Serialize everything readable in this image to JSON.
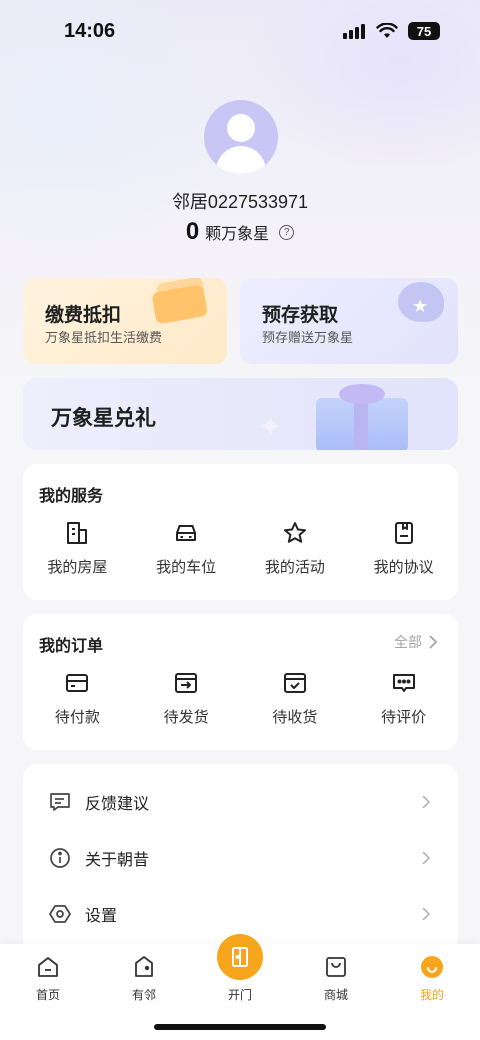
{
  "status_bar": {
    "time": "14:06",
    "battery": "75"
  },
  "profile": {
    "username": "邻居0227533971",
    "stars_count": "0",
    "stars_label": "颗万象星"
  },
  "promos": [
    {
      "title": "缴费抵扣",
      "subtitle": "万象星抵扣生活缴费"
    },
    {
      "title": "预存获取",
      "subtitle": "预存赠送万象星"
    }
  ],
  "exchange": {
    "title": "万象星兑礼"
  },
  "services": {
    "title": "我的服务",
    "items": [
      {
        "label": "我的房屋",
        "icon": "building-icon"
      },
      {
        "label": "我的车位",
        "icon": "car-icon"
      },
      {
        "label": "我的活动",
        "icon": "star-icon"
      },
      {
        "label": "我的协议",
        "icon": "document-icon"
      }
    ]
  },
  "orders": {
    "title": "我的订单",
    "more": "全部",
    "items": [
      {
        "label": "待付款",
        "icon": "card-icon"
      },
      {
        "label": "待发货",
        "icon": "ship-box-icon"
      },
      {
        "label": "待收货",
        "icon": "receive-box-icon"
      },
      {
        "label": "待评价",
        "icon": "comment-icon"
      }
    ]
  },
  "menu": [
    {
      "label": "反馈建议",
      "icon": "feedback-icon"
    },
    {
      "label": "关于朝昔",
      "icon": "info-icon"
    },
    {
      "label": "设置",
      "icon": "settings-icon"
    }
  ],
  "nav": {
    "items": [
      {
        "label": "首页",
        "icon": "home-icon"
      },
      {
        "label": "有邻",
        "icon": "neighbor-icon"
      },
      {
        "label": "开门",
        "icon": "door-icon"
      },
      {
        "label": "商城",
        "icon": "shop-icon"
      },
      {
        "label": "我的",
        "icon": "profile-icon"
      }
    ],
    "active": "我的",
    "accent_color": "#f6a51c"
  }
}
